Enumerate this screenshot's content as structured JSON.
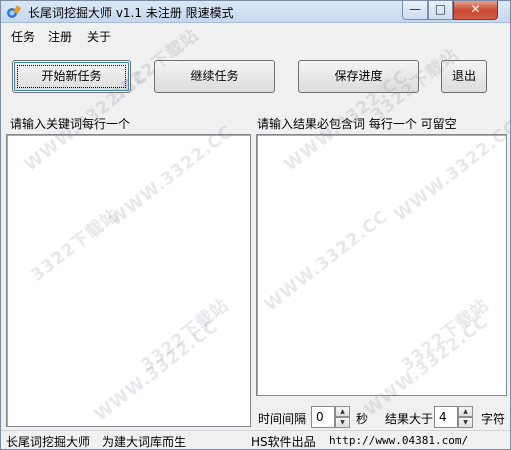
{
  "window": {
    "title": "长尾词挖掘大师 v1.1  未注册  限速模式",
    "min_glyph": "—",
    "max_glyph": "□",
    "close_glyph": "✕"
  },
  "menu": {
    "task": "任务",
    "register": "注册",
    "about": "关于"
  },
  "toolbar": {
    "start_label": "开始新任务",
    "continue_label": "继续任务",
    "save_label": "保存进度",
    "exit_label": "退出"
  },
  "left_panel": {
    "label": "请输入关键词每行一个",
    "value": ""
  },
  "right_panel": {
    "label": "请输入结果必包含词   每行一个  可留空",
    "value": ""
  },
  "options": {
    "interval_label": "时间间隔",
    "interval_value": "0",
    "interval_unit": "秒",
    "min_length_label": "结果大于",
    "min_length_value": "4",
    "min_length_unit": "字符",
    "spin_up": "▲",
    "spin_down": "▼"
  },
  "status": {
    "app_name": "长尾词挖掘大师",
    "slogan": "为建大词库而生",
    "vendor": "HS软件出品",
    "url": "http://www.04381.com/"
  },
  "watermarks": [
    "3322下载站",
    "WWW.3322.CC",
    "3322下载站",
    "WWW.3322.CC",
    "3322下载站",
    "WWW.3322.CC",
    "3322下载站",
    "WWW.3322.CC",
    "3322下载站",
    "WWW.3322.CC",
    "WWW.3322.CC",
    "WWW.3322.CC"
  ]
}
